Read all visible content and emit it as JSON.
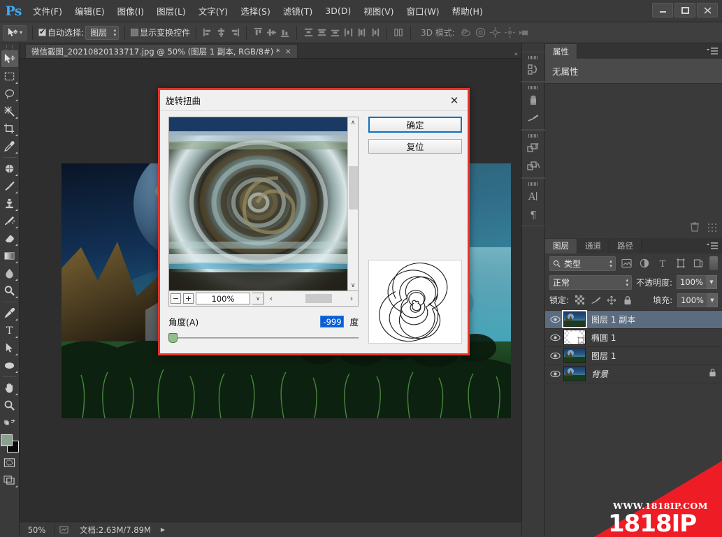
{
  "app": {
    "logo": "Ps",
    "window_buttons": [
      "minimize",
      "maximize",
      "close"
    ]
  },
  "menubar": {
    "items": [
      {
        "label": "文件(F)",
        "name": "menu-file"
      },
      {
        "label": "编辑(E)",
        "name": "menu-edit"
      },
      {
        "label": "图像(I)",
        "name": "menu-image"
      },
      {
        "label": "图层(L)",
        "name": "menu-layer"
      },
      {
        "label": "文字(Y)",
        "name": "menu-type"
      },
      {
        "label": "选择(S)",
        "name": "menu-select"
      },
      {
        "label": "滤镜(T)",
        "name": "menu-filter"
      },
      {
        "label": "3D(D)",
        "name": "menu-3d"
      },
      {
        "label": "视图(V)",
        "name": "menu-view"
      },
      {
        "label": "窗口(W)",
        "name": "menu-window"
      },
      {
        "label": "帮助(H)",
        "name": "menu-help"
      }
    ]
  },
  "options_bar": {
    "auto_select_label": "自动选择:",
    "auto_select_checked": true,
    "auto_select_value": "图层",
    "show_transform_label": "显示变换控件",
    "show_transform_checked": false,
    "mode3d_label": "3D 模式:"
  },
  "document_tab": {
    "title": "微信截图_20210820133717.jpg @ 50% (图层 1 副本, RGB/8#) *",
    "close": "×"
  },
  "status_bar": {
    "zoom": "50%",
    "doc_info": "文档:2.63M/7.89M",
    "expand": "▶"
  },
  "properties_panel": {
    "tab": "属性",
    "empty_text": "无属性"
  },
  "layers_panel": {
    "tabs": [
      {
        "label": "图层",
        "active": true
      },
      {
        "label": "通道",
        "active": false
      },
      {
        "label": "路径",
        "active": false
      }
    ],
    "filter_label": "类型",
    "blend_mode": "正常",
    "opacity_label": "不透明度:",
    "opacity_value": "100%",
    "lock_label": "锁定:",
    "fill_label": "填充:",
    "fill_value": "100%",
    "layers": [
      {
        "name": "图层 1 副本",
        "selected": true,
        "locked": false,
        "thumb": "photo"
      },
      {
        "name": "椭圆 1",
        "selected": false,
        "locked": false,
        "thumb": "shape"
      },
      {
        "name": "图层 1",
        "selected": false,
        "locked": false,
        "thumb": "photo"
      },
      {
        "name": "背景",
        "selected": false,
        "locked": true,
        "thumb": "photo"
      }
    ]
  },
  "dialog": {
    "title": "旋转扭曲",
    "close": "✕",
    "ok_label": "确定",
    "reset_label": "复位",
    "zoom_value": "100%",
    "zoom_out": "−",
    "zoom_in": "+",
    "angle_label": "角度(A)",
    "angle_value": "-999",
    "angle_unit": "度"
  },
  "watermark": {
    "url": "WWW.1818IP.COM",
    "brand": "1818IP",
    "color": "#ee1c25"
  },
  "colors": {
    "accent_red": "#e8342a",
    "selection_blue": "#0a5fd6",
    "panel_bg": "#3a3a3a",
    "dialog_bg": "#f0f0f0",
    "foreground_swatch": "#8ba18f",
    "background_swatch": "#0a0a0a"
  }
}
